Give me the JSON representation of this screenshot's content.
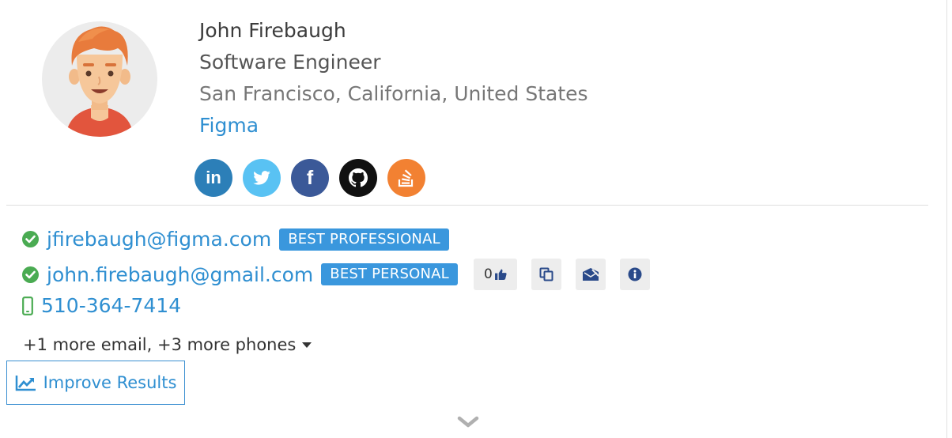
{
  "profile": {
    "name": "John Firebaugh",
    "title": "Software Engineer",
    "location": "San Francisco, California, United States",
    "company": "Figma"
  },
  "social": [
    {
      "network": "linkedin",
      "icon": "linkedin-icon",
      "label": "in",
      "color": "#2c7fb8"
    },
    {
      "network": "twitter",
      "icon": "twitter-icon",
      "color": "#59c2f3"
    },
    {
      "network": "facebook",
      "icon": "facebook-icon",
      "label": "f",
      "color": "#3b5998"
    },
    {
      "network": "github",
      "icon": "github-icon",
      "color": "#111111"
    },
    {
      "network": "stackoverflow",
      "icon": "stackoverflow-icon",
      "color": "#f28132"
    }
  ],
  "contacts": {
    "emails": [
      {
        "address": "jfirebaugh@figma.com",
        "badge": "BEST PROFESSIONAL",
        "verified": true
      },
      {
        "address": "john.firebaugh@gmail.com",
        "badge": "BEST PERSONAL",
        "verified": true
      }
    ],
    "feedback_count": "0",
    "phone": "510-364-7414",
    "more_label": "+1 more email, +3 more phones"
  },
  "actions": {
    "improve_label": "Improve Results"
  },
  "colors": {
    "accent": "#2f8fd1",
    "badge": "#3a97dd",
    "verified": "#4aab52"
  }
}
